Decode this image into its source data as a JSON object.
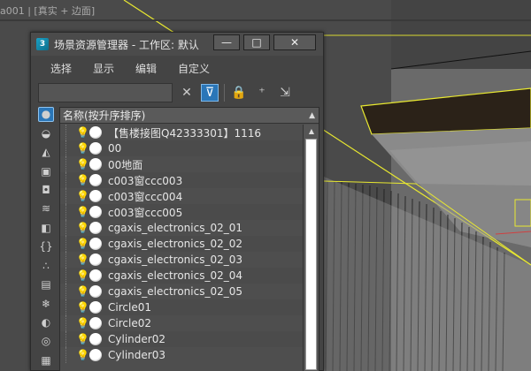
{
  "viewport": {
    "label": "a001 | [真实 + 边面]"
  },
  "window": {
    "title": "场景资源管理器 - 工作区: 默认",
    "logo_text": "3",
    "buttons": {
      "minimize": "—",
      "maximize": "□",
      "close": "✕"
    }
  },
  "menu": [
    "选择",
    "显示",
    "编辑",
    "自定义"
  ],
  "toolbar": {
    "search_value": "",
    "clear_glyph": "✕",
    "filter_glyph": "⊽",
    "lock_glyph": "🔒",
    "add_glyph": "⁺",
    "link_glyph": "⇲"
  },
  "side_tools": [
    "geometry-icon",
    "shapes-icon",
    "lights-icon",
    "cameras-icon",
    "helpers-icon",
    "spacewarps-icon",
    "groups-icon",
    "xrefs-icon",
    "bones-icon",
    "containers-icon",
    "frozen-icon",
    "hidden-icon",
    "layers-icon",
    "display-all-icon"
  ],
  "list": {
    "header": "名称(按升序排序)",
    "sort_glyph": "▲",
    "rows": [
      "【售楼接图Q42333301】1116",
      "00",
      "00地面",
      "c003窗ccc003",
      "c003窗ccc004",
      "c003窗ccc005",
      "cgaxis_electronics_02_01",
      "cgaxis_electronics_02_02",
      "cgaxis_electronics_02_03",
      "cgaxis_electronics_02_04",
      "cgaxis_electronics_02_05",
      "Circle01",
      "Circle02",
      "Cylinder02",
      "Cylinder03"
    ]
  },
  "colors": {
    "selection_yellow": "#e8e830",
    "accent_blue": "#2a76b8"
  }
}
